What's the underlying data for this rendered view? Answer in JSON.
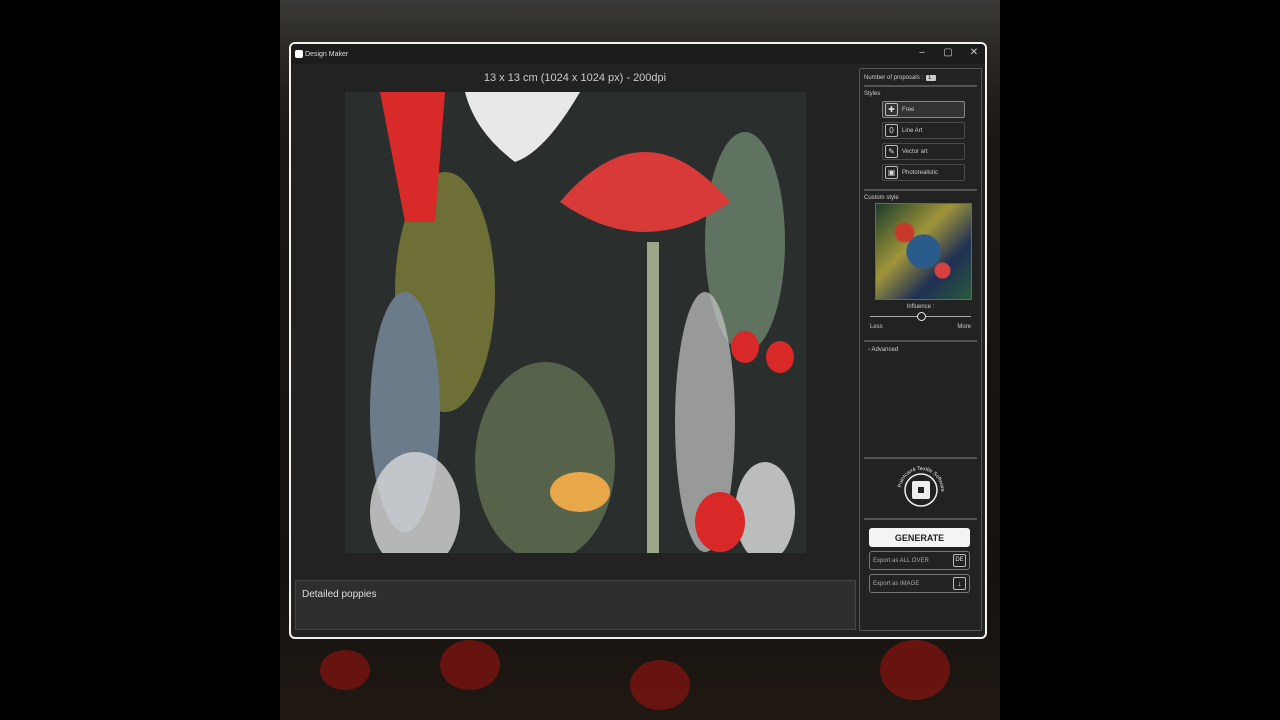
{
  "window": {
    "title": "Design Maker",
    "minimize": "–",
    "maximize": "▢",
    "close": "✕"
  },
  "canvas": {
    "dimensions": "13 x 13 cm (1024 x 1024 px) - 200dpi"
  },
  "prompt": {
    "value": "Detailed poppies"
  },
  "panel": {
    "proposals_label": "Number of proposals :",
    "proposals_value": "1",
    "styles_label": "Styles",
    "styles": [
      {
        "label": "Free",
        "icon": "free-icon",
        "selected": true
      },
      {
        "label": "Line Art",
        "icon": "line-art-icon"
      },
      {
        "label": "Vector art",
        "icon": "feather-icon"
      },
      {
        "label": "Photorealistic",
        "icon": "photo-icon"
      }
    ],
    "custom_style_label": "Custom style",
    "influence_label": "Influence :",
    "influence_value": 0.5,
    "less": "Less",
    "more": "More",
    "advanced": "Advanced",
    "brand": "Pointcarré Textile Software",
    "generate": "GENERATE",
    "export_allover": "Export as ALL OVER",
    "export_allover_icon": "DE",
    "export_image": "Export as IMAGE",
    "export_image_icon": "↓"
  }
}
